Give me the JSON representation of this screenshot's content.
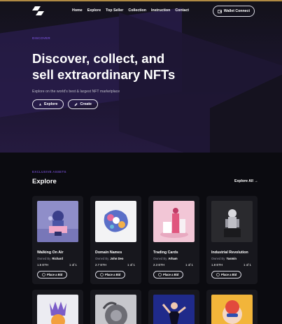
{
  "header": {
    "nav": [
      "Home",
      "Explore",
      "Top Seller",
      "Collection",
      "Instruction",
      "Contact"
    ],
    "wallet_button": "Wallet Connect"
  },
  "hero": {
    "eyebrow": "DISCOVER",
    "title": "Discover, collect, and sell extraordinary NFTs",
    "subtitle": "Explore on the world's best & largest NFT marketplace",
    "explore_button": "Explore",
    "create_button": "Create"
  },
  "section": {
    "label": "EXCLUSIVE ASSETS",
    "title": "Explore",
    "explore_all": "Explore All →"
  },
  "cards": [
    {
      "name": "Walking On Air",
      "owned_by": "Owned By",
      "owner": "Richard",
      "price": "1.5 ETH",
      "stock": "1 of 1",
      "bid": "Place a Bid"
    },
    {
      "name": "Domain Names",
      "owned_by": "Owned By",
      "owner": "John Deo",
      "price": "2.7 ETH",
      "stock": "1 of 1",
      "bid": "Place a Bid"
    },
    {
      "name": "Trading Cards",
      "owned_by": "Owned By",
      "owner": "Arham",
      "price": "2.3 ETH",
      "stock": "1 of 1",
      "bid": "Place a Bid"
    },
    {
      "name": "Industrial Revolution",
      "owned_by": "Owned By",
      "owner": "Yasmin",
      "price": "1.8 ETH",
      "stock": "1 of 1",
      "bid": "Place a Bid"
    }
  ],
  "colors": {
    "accent": "#8a5cf6",
    "background": "#0b0b10",
    "card": "#17171d",
    "topline": "#b08a43"
  }
}
